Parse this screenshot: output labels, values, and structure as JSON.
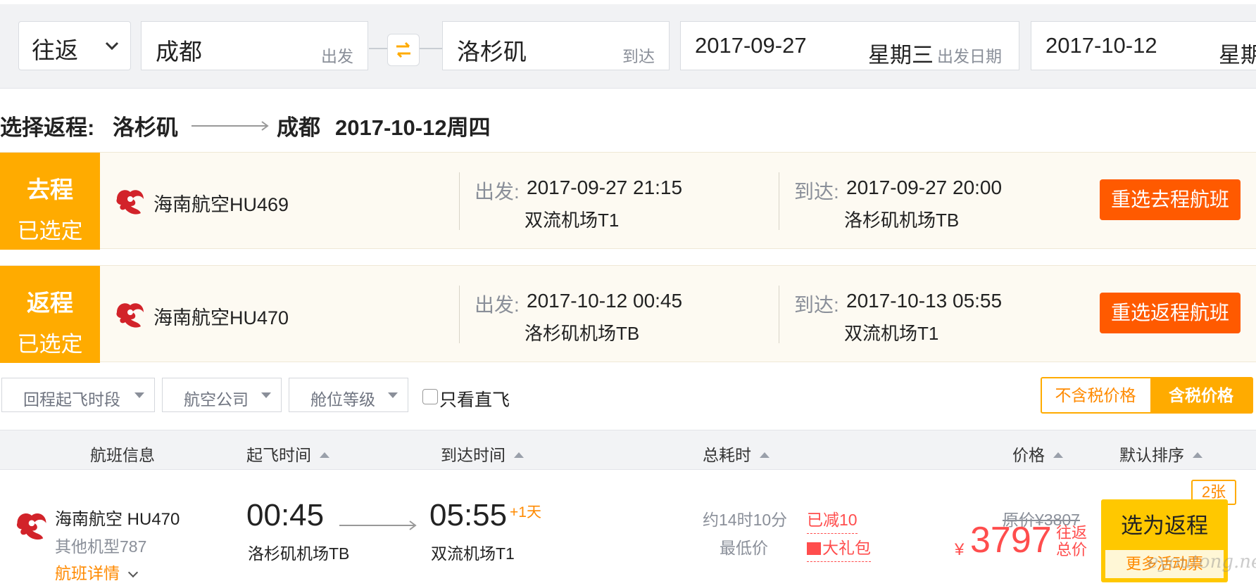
{
  "search": {
    "trip_type": "往返",
    "from_city": "成都",
    "from_hint": "出发",
    "to_city": "洛杉矶",
    "to_hint": "到达",
    "depart_date": "2017-09-27",
    "depart_weekday": "星期三",
    "depart_hint": "出发日期",
    "return_date": "2017-10-12",
    "return_weekday": "星期"
  },
  "route": {
    "label": "选择返程:",
    "from": "洛杉矶",
    "to": "成都",
    "date": "2017-10-12周四"
  },
  "selected": [
    {
      "tag_line1": "去程",
      "tag_line2": "已选定",
      "airline": "海南航空HU469",
      "dep_label": "出发:",
      "dep_datetime": "2017-09-27 21:15",
      "dep_airport": "双流机场T1",
      "arr_label": "到达:",
      "arr_datetime": "2017-09-27 20:00",
      "arr_airport": "洛杉矶机场TB",
      "button": "重选去程航班"
    },
    {
      "tag_line1": "返程",
      "tag_line2": "已选定",
      "airline": "海南航空HU470",
      "dep_label": "出发:",
      "dep_datetime": "2017-10-12 00:45",
      "dep_airport": "洛杉矶机场TB",
      "arr_label": "到达:",
      "arr_datetime": "2017-10-13 05:55",
      "arr_airport": "双流机场T1",
      "button": "重选返程航班"
    }
  ],
  "filters": {
    "departure_time": "回程起飞时段",
    "airline": "航空公司",
    "cabin_class": "舱位等级",
    "direct_only": "只看直飞",
    "price_excl_tax": "不含税价格",
    "price_incl_tax": "含税价格"
  },
  "list_header": {
    "flight_info": "航班信息",
    "depart_time": "起飞时间",
    "arrive_time": "到达时间",
    "duration": "总耗时",
    "price": "价格",
    "sort": "默认排序"
  },
  "flight": {
    "airline_flight": "海南航空 HU470",
    "aircraft": "其他机型787",
    "details_link": "航班详情",
    "depart_time": "00:45",
    "depart_airport": "洛杉矶机场TB",
    "arrive_time": "05:55",
    "next_day": "+1天",
    "arrive_airport": "双流机场T1",
    "duration": "约14时10分",
    "lowest": "最低价",
    "reduced": "已减10",
    "gift": "大礼包",
    "original_price": "原价¥3807",
    "currency": "¥",
    "price": "3797",
    "price_note": "往返总价",
    "ticket_count": "2张",
    "select_button": "选为返程",
    "more_offers": "更多活动票"
  },
  "watermark": "eyoutong.net",
  "colors": {
    "accent_orange": "#ff5a00",
    "tag_yellow": "#ffab00",
    "price_red": "#ff4d4d",
    "select_yellow": "#ffc800"
  },
  "icons": {
    "trip_dropdown": "chevron-down-icon",
    "swap": "swap-arrows-icon",
    "airline_logo": "hainan-airlines-logo",
    "route_arrow": "arrow-right-icon"
  }
}
